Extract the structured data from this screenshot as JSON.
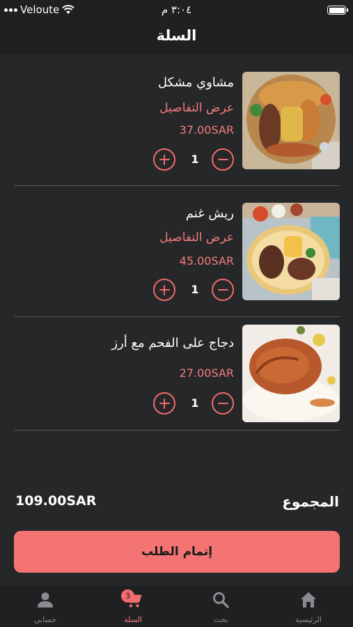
{
  "status_bar": {
    "carrier": "Veloute",
    "time": "٣:٠٤ م"
  },
  "header": {
    "title": "السلة"
  },
  "cart": {
    "items": [
      {
        "name": "مشاوي مشكل",
        "details_link": "عرض التفاصيل",
        "price": "37.00SAR",
        "quantity": "1"
      },
      {
        "name": "ريش غنم",
        "details_link": "عرض التفاصيل",
        "price": "45.00SAR",
        "quantity": "1"
      },
      {
        "name": "دجاج على الفحم مع أرز",
        "price": "27.00SAR",
        "quantity": "1"
      }
    ]
  },
  "summary": {
    "total_label": "المجموع",
    "total_value": "109.00SAR"
  },
  "checkout": {
    "label": "إتمام الطلب"
  },
  "tabs": [
    {
      "label": "الرئيسية",
      "icon": "home-icon"
    },
    {
      "label": "بحث",
      "icon": "search-icon"
    },
    {
      "label": "السلة",
      "icon": "cart-icon",
      "badge": "3",
      "active": true
    },
    {
      "label": "حسابي",
      "icon": "person-icon"
    }
  ],
  "colors": {
    "accent": "#f47474",
    "background": "#262729",
    "bar": "#1f2022"
  }
}
